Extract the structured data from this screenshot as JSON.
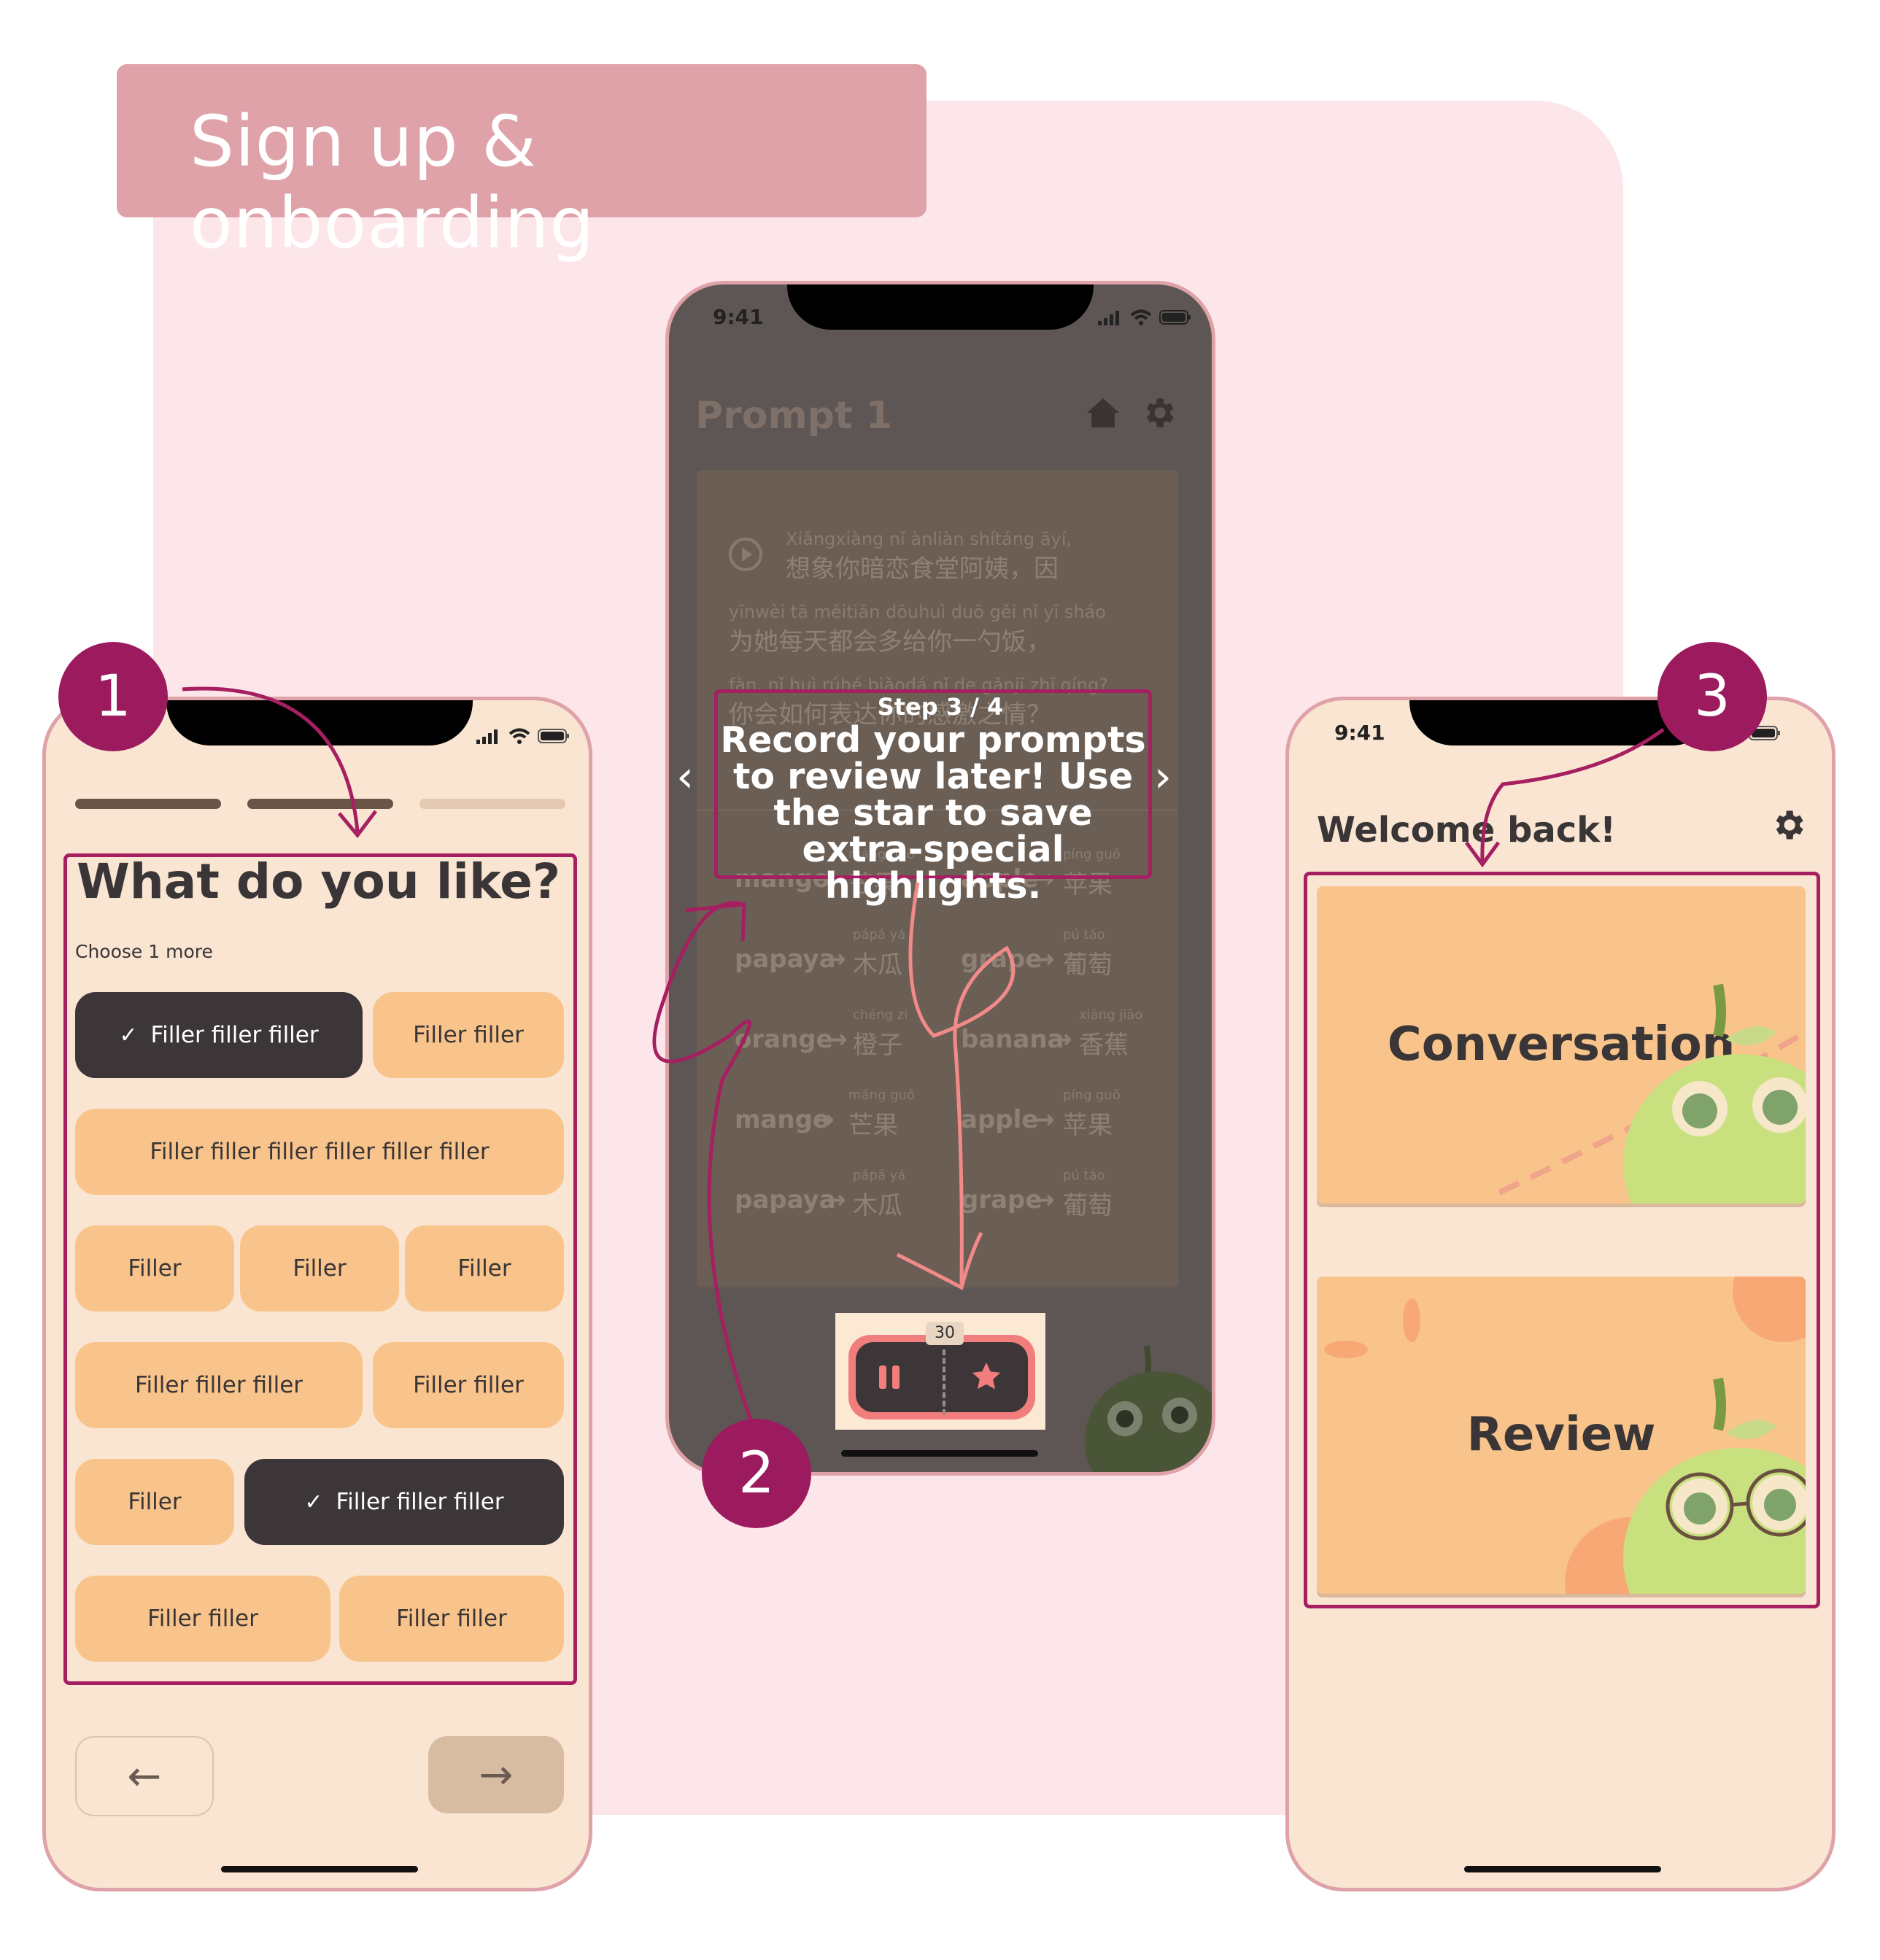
{
  "header": {
    "title": "Sign up & onboarding"
  },
  "colors": {
    "accent": "#a51f61",
    "badge": "#9c1a5e",
    "chip": "#f9c48b",
    "chip_selected": "#3d3638",
    "phone_bg": "#f9e5d1",
    "pink_bg": "#fde6ea"
  },
  "badges": [
    "1",
    "2",
    "3"
  ],
  "phone1": {
    "question": "What do you like?",
    "hint": "Choose 1 more",
    "progress": {
      "steps": 3,
      "completed": 2
    },
    "chips": [
      {
        "label": "Filler filler filler",
        "selected": true
      },
      {
        "label": "Filler filler",
        "selected": false
      },
      {
        "label": "Filler filler filler filler filler filler",
        "selected": false
      },
      {
        "label": "Filler",
        "selected": false
      },
      {
        "label": "Filler",
        "selected": false
      },
      {
        "label": "Filler",
        "selected": false
      },
      {
        "label": "Filler filler filler",
        "selected": false
      },
      {
        "label": "Filler filler",
        "selected": false
      },
      {
        "label": "Filler",
        "selected": false
      },
      {
        "label": "Filler filler filler",
        "selected": true
      },
      {
        "label": "Filler filler",
        "selected": false
      },
      {
        "label": "Filler filler",
        "selected": false
      }
    ],
    "back_icon": "arrow-left-icon",
    "next_icon": "arrow-right-icon",
    "back": "←",
    "next": "→"
  },
  "phone2": {
    "time": "9:41",
    "title": "Prompt 1",
    "passage": [
      {
        "pinyin": "Xiǎngxiàng nǐ ànliàn shítáng āyí,",
        "hanzi": "想象你暗恋食堂阿姨，因"
      },
      {
        "pinyin": "yīnwèi tā měitiān dōuhuì duō gěi nǐ yī sháo",
        "hanzi": "为她每天都会多给你一勺饭，"
      },
      {
        "pinyin": "fàn, nǐ huì rúhé biǎodá nǐ de gǎnjī zhī qíng?",
        "hanzi": "你会如何表达你的感激之情？"
      }
    ],
    "vocab": [
      {
        "word": "mango",
        "pinyin": "máng guǒ",
        "hanzi": "芒果"
      },
      {
        "word": "apple",
        "pinyin": "píng guǒ",
        "hanzi": "苹果"
      },
      {
        "word": "papaya",
        "pinyin": "pápá yá",
        "hanzi": "木瓜"
      },
      {
        "word": "grape",
        "pinyin": "pú táo",
        "hanzi": "葡萄"
      },
      {
        "word": "orange",
        "pinyin": "chéng zi",
        "hanzi": "橙子"
      },
      {
        "word": "banana",
        "pinyin": "xiāng jiāo",
        "hanzi": "香蕉"
      },
      {
        "word": "mango",
        "pinyin": "máng guǒ",
        "hanzi": "芒果"
      },
      {
        "word": "apple",
        "pinyin": "píng guǒ",
        "hanzi": "苹果"
      },
      {
        "word": "papaya",
        "pinyin": "pápá yá",
        "hanzi": "木瓜"
      },
      {
        "word": "grape",
        "pinyin": "pú táo",
        "hanzi": "葡萄"
      }
    ],
    "arrow": "→",
    "step": "Step 3 / 4",
    "tooltip": "Record your prompts to review later! Use the star to save extra-special highlights.",
    "timer": "30",
    "prev": "‹",
    "next": "›"
  },
  "phone3": {
    "time": "9:41",
    "greeting": "Welcome back!",
    "cards": [
      "Conversation",
      "Review"
    ]
  }
}
